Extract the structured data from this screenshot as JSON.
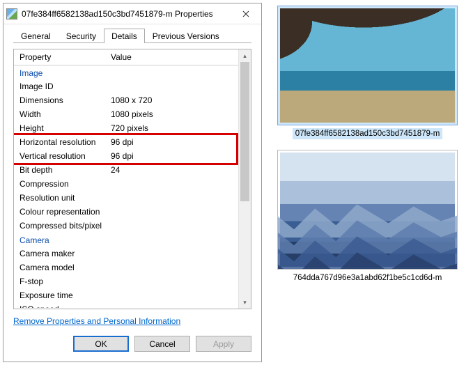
{
  "dialog": {
    "title": "07fe384ff6582138ad150c3bd7451879-m Properties",
    "tabs": {
      "general": "General",
      "security": "Security",
      "details": "Details",
      "previous": "Previous Versions"
    },
    "headers": {
      "property": "Property",
      "value": "Value"
    },
    "sections": {
      "image": {
        "label": "Image",
        "rows": [
          {
            "p": "Image ID",
            "v": ""
          },
          {
            "p": "Dimensions",
            "v": "1080 x 720"
          },
          {
            "p": "Width",
            "v": "1080 pixels"
          },
          {
            "p": "Height",
            "v": "720 pixels"
          }
        ],
        "highlighted": [
          {
            "p": "Horizontal resolution",
            "v": "96 dpi"
          },
          {
            "p": "Vertical resolution",
            "v": "96 dpi"
          }
        ],
        "rows2": [
          {
            "p": "Bit depth",
            "v": "24"
          },
          {
            "p": "Compression",
            "v": ""
          },
          {
            "p": "Resolution unit",
            "v": ""
          },
          {
            "p": "Colour representation",
            "v": ""
          },
          {
            "p": "Compressed bits/pixel",
            "v": ""
          }
        ]
      },
      "camera": {
        "label": "Camera",
        "rows": [
          {
            "p": "Camera maker",
            "v": ""
          },
          {
            "p": "Camera model",
            "v": ""
          },
          {
            "p": "F-stop",
            "v": ""
          },
          {
            "p": "Exposure time",
            "v": ""
          },
          {
            "p": "ISO speed",
            "v": ""
          }
        ]
      }
    },
    "link": "Remove Properties and Personal Information",
    "buttons": {
      "ok": "OK",
      "cancel": "Cancel",
      "apply": "Apply"
    }
  },
  "thumbs": {
    "a": "07fe384ff6582138ad150c3bd7451879-m",
    "b": "764dda767d96e3a1abd62f1be5c1cd6d-m"
  }
}
